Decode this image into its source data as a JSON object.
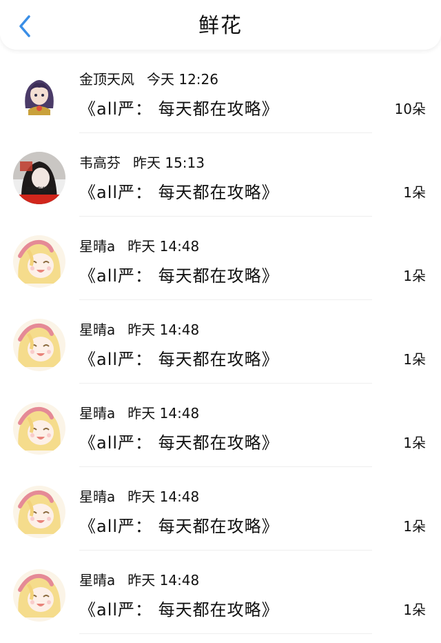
{
  "header": {
    "title": "鲜花",
    "back_icon": "chevron-left-icon",
    "accent_color": "#3a8ee6"
  },
  "records": [
    {
      "user": "金顶天风",
      "time": "今天 12:26",
      "book": "《all严： 每天都在攻略》",
      "count": "10朵",
      "avatar": "anime-girl-purple-hair"
    },
    {
      "user": "韦高芬",
      "time": "昨天 15:13",
      "book": "《all严： 每天都在攻略》",
      "count": "1朵",
      "avatar": "photo-girl-with-text",
      "avatar_text": "每秒在想你"
    },
    {
      "user": "星晴a",
      "time": "昨天 14:48",
      "book": "《all严： 每天都在攻略》",
      "count": "1朵",
      "avatar": "anime-girl-blonde"
    },
    {
      "user": "星晴a",
      "time": "昨天 14:48",
      "book": "《all严： 每天都在攻略》",
      "count": "1朵",
      "avatar": "anime-girl-blonde"
    },
    {
      "user": "星晴a",
      "time": "昨天 14:48",
      "book": "《all严： 每天都在攻略》",
      "count": "1朵",
      "avatar": "anime-girl-blonde"
    },
    {
      "user": "星晴a",
      "time": "昨天 14:48",
      "book": "《all严： 每天都在攻略》",
      "count": "1朵",
      "avatar": "anime-girl-blonde"
    },
    {
      "user": "星晴a",
      "time": "昨天 14:48",
      "book": "《all严： 每天都在攻略》",
      "count": "1朵",
      "avatar": "anime-girl-blonde"
    }
  ]
}
